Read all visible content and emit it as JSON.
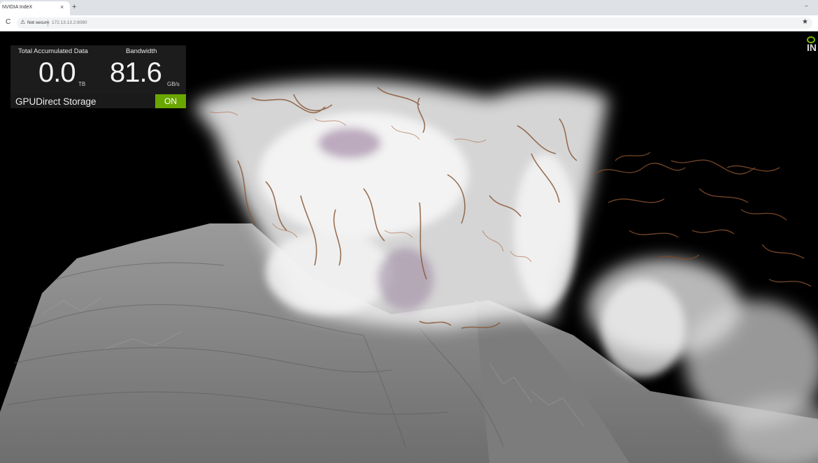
{
  "browser": {
    "tab_title": "NVIDIA IndeX",
    "tab_close": "×",
    "new_tab": "+",
    "minimize": "–",
    "reload": "C",
    "security_label": "Not secure",
    "url": "172.13.13.2:8080",
    "bookmark_icon": "star-icon"
  },
  "stats_panel": {
    "accumulated_label": "Total Accumulated Data",
    "accumulated_value": "0.0",
    "accumulated_unit": "TB",
    "bandwidth_label": "Bandwidth",
    "bandwidth_value": "81.6",
    "bandwidth_unit": "GB/s",
    "gds_label": "GPUDirect Storage",
    "gds_state": "ON"
  },
  "logo": {
    "text": "IN",
    "accent": "#76b900"
  },
  "colors": {
    "toggle_on": "#6aa600",
    "panel_bg": "#1e1e1e",
    "terrain": "#8e8e8e",
    "cloud": "#f0f0f0",
    "fibers": "#8a5a3a"
  }
}
